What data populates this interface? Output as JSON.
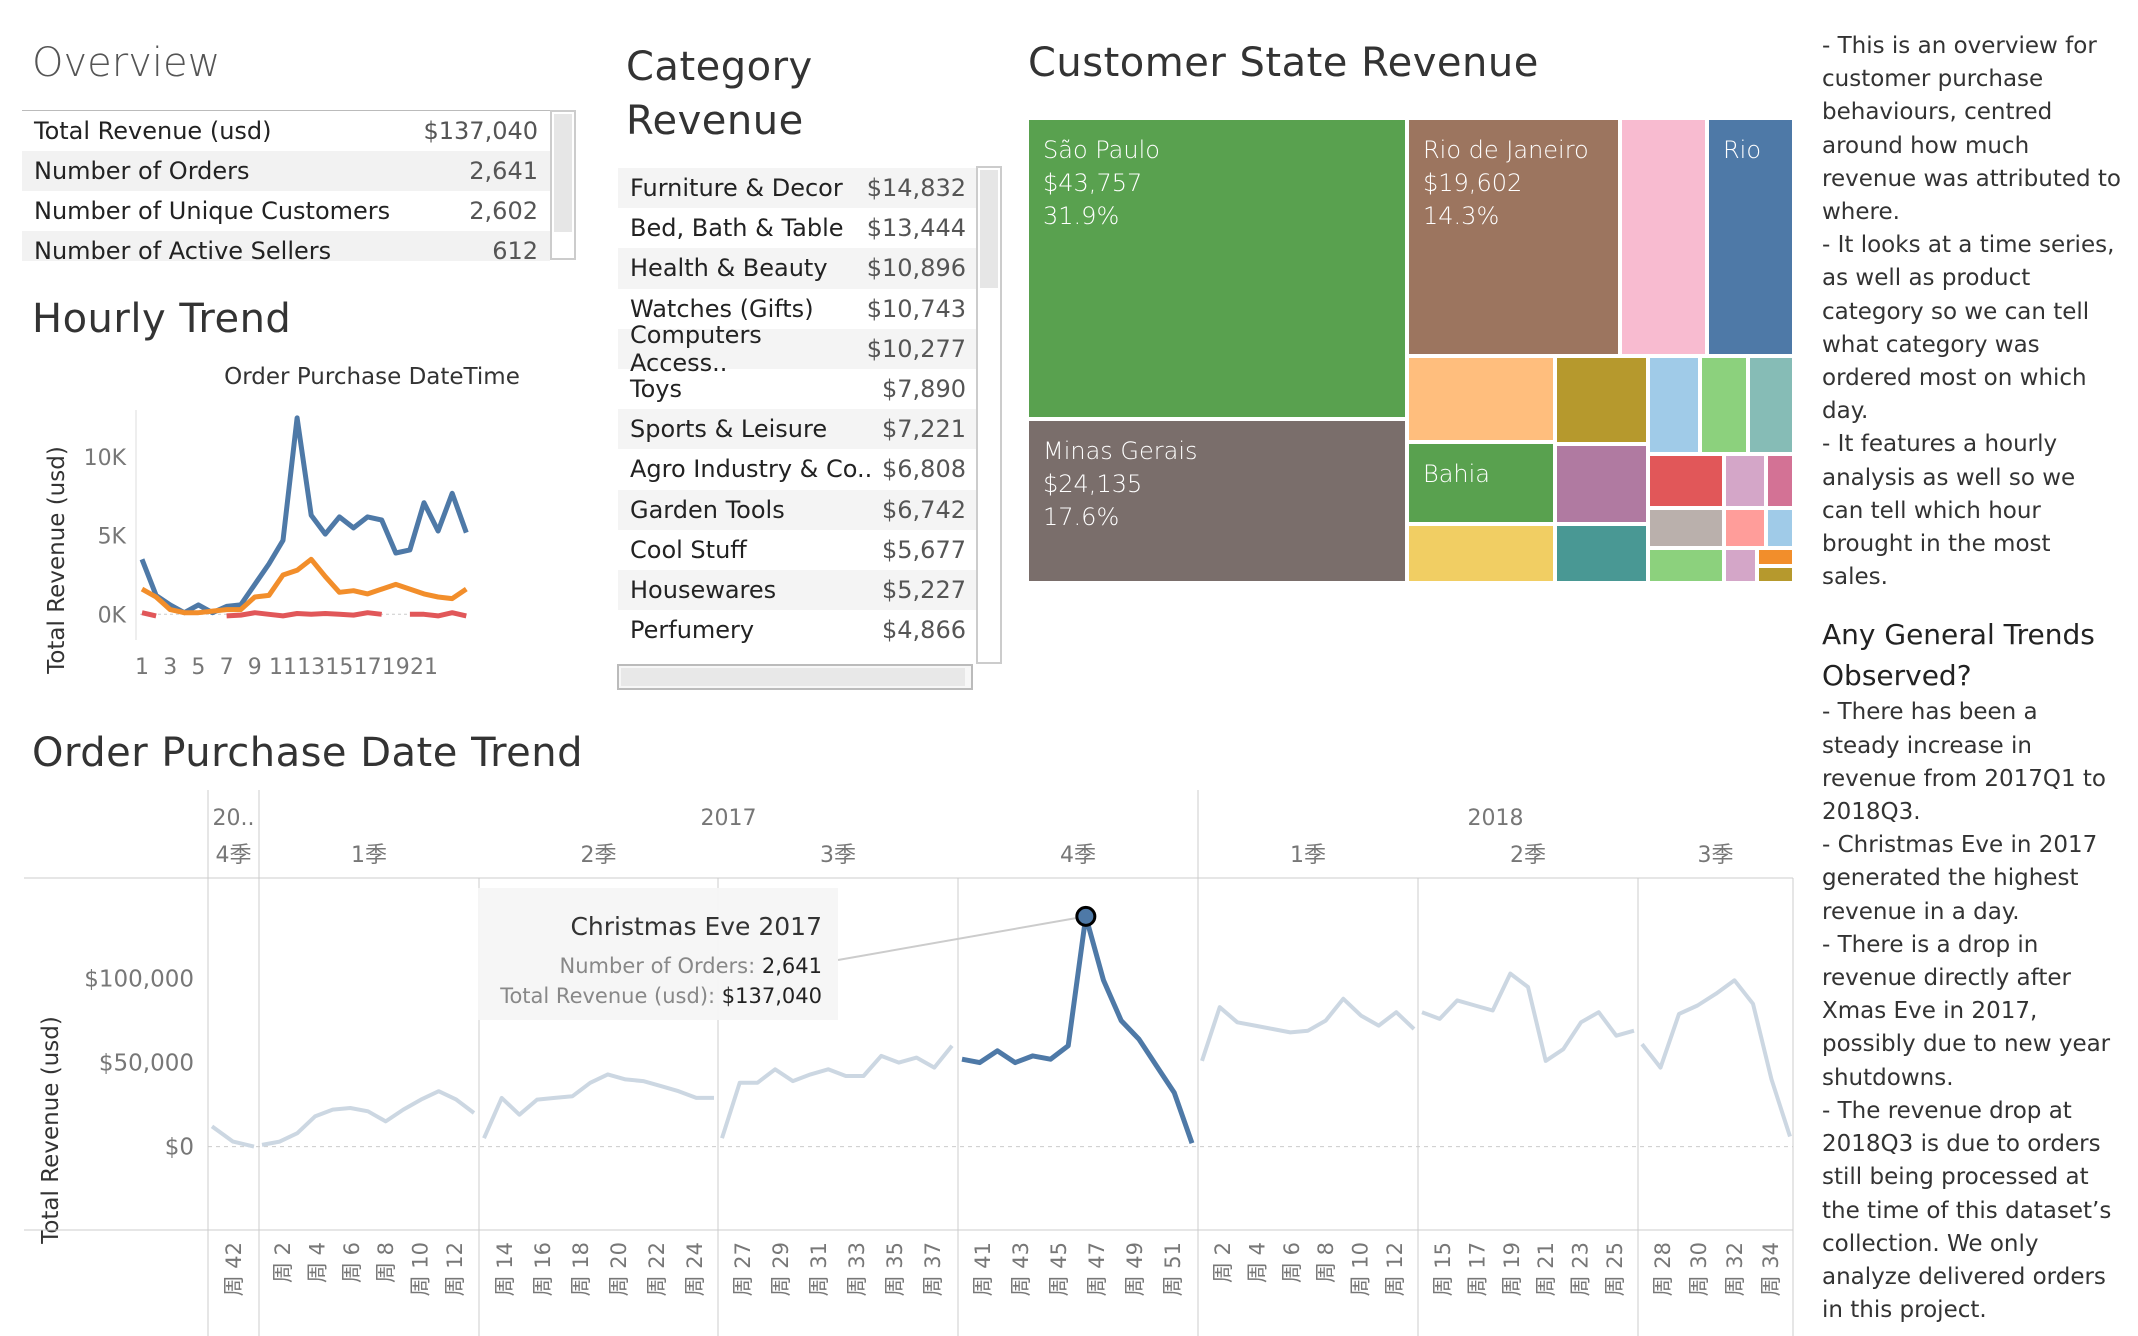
{
  "overview": {
    "title": "Overview",
    "rows": [
      {
        "label": "Total Revenue  (usd)",
        "value": "$137,040"
      },
      {
        "label": "Number of Orders",
        "value": "2,641"
      },
      {
        "label": "Number of Unique Customers",
        "value": "2,602"
      },
      {
        "label": "Number of Active Sellers",
        "value": "612"
      }
    ]
  },
  "hourly": {
    "title": "Hourly Trend",
    "chart_title": "Order Purchase DateTime",
    "ylabel": "Total Revenue  (usd)"
  },
  "category": {
    "title_line1": "Category",
    "title_line2": "Revenue",
    "rows": [
      {
        "label": "Furniture & Decor",
        "value": "$14,832"
      },
      {
        "label": "Bed, Bath & Table",
        "value": "$13,444"
      },
      {
        "label": "Health & Beauty",
        "value": "$10,896"
      },
      {
        "label": "Watches (Gifts)",
        "value": "$10,743"
      },
      {
        "label": "Computers Access..",
        "value": "$10,277"
      },
      {
        "label": "Toys",
        "value": "$7,890"
      },
      {
        "label": "Sports & Leisure",
        "value": "$7,221"
      },
      {
        "label": "Agro Industry & Co..",
        "value": "$6,808"
      },
      {
        "label": "Garden Tools",
        "value": "$6,742"
      },
      {
        "label": "Cool Stuff",
        "value": "$5,677"
      },
      {
        "label": "Housewares",
        "value": "$5,227"
      },
      {
        "label": "Perfumery",
        "value": "$4,866"
      }
    ]
  },
  "state": {
    "title": "Customer State Revenue",
    "tiles": [
      {
        "name": "São Paulo",
        "revenue": "$43,757",
        "pct": "31.9%",
        "color": "#59a14f"
      },
      {
        "name": "Minas Gerais",
        "revenue": "$24,135",
        "pct": "17.6%",
        "color": "#7a6e6b"
      },
      {
        "name": "Rio de Janeiro",
        "revenue": "$19,602",
        "pct": "14.3%",
        "color": "#9c755f"
      },
      {
        "name": "Rio",
        "color": "#4e79a7"
      },
      {
        "name": "Bahia",
        "color": "#59a14f"
      }
    ]
  },
  "notes": {
    "intro": "- This is an overview for customer purchase behaviours, centred around how much revenue was attributed to where.",
    "p2": "- It looks at a time series, as well as product category so we can tell what category was ordered most on which day.",
    "p3": "- It features a hourly analysis as well so we can tell which hour brought in the most sales.",
    "heading": "Any General Trends Observed?",
    "t1": "- There has been a steady increase in revenue from 2017Q1 to 2018Q3.",
    "t2": "- Christmas Eve in 2017 generated the highest revenue in a day.",
    "t3": "- There is a drop in revenue directly after Xmas Eve in 2017, possibly due to new year shutdowns.",
    "t4": "- The revenue drop at 2018Q3 is due to orders still being processed at the time of this dataset’s collection. We only analyze delivered orders in this project."
  },
  "trend": {
    "title": "Order Purchase Date Trend",
    "ylabel": "Total Revenue  (usd)",
    "years": [
      "20..",
      "2017",
      "2018"
    ],
    "quarters": [
      "4季",
      "1季",
      "2季",
      "3季",
      "4季",
      "1季",
      "2季",
      "3季"
    ],
    "tooltip": {
      "title": "Christmas Eve 2017",
      "orders_label": "Number of Orders:",
      "orders_value": "2,641",
      "revenue_label": "Total Revenue  (usd):",
      "revenue_value": "$137,040"
    }
  },
  "chart_data": [
    {
      "type": "line",
      "title": "Order Purchase DateTime",
      "ylabel": "Total Revenue  (usd)",
      "x": [
        0,
        1,
        2,
        3,
        4,
        5,
        6,
        7,
        8,
        9,
        10,
        11,
        12,
        13,
        14,
        15,
        16,
        17,
        18,
        19,
        20,
        21,
        22,
        23
      ],
      "x_tick_labels": [
        "1",
        "3",
        "5",
        "7",
        "9",
        "11",
        "13",
        "15",
        "17",
        "19",
        "21"
      ],
      "y_ticks": [
        "0K",
        "5K",
        "10K"
      ],
      "ylim": [
        -1000,
        13000
      ],
      "series": [
        {
          "color": "#4e79a7",
          "values": [
            3500,
            1200,
            600,
            100,
            600,
            100,
            500,
            600,
            1900,
            3200,
            4700,
            12500,
            6300,
            5100,
            6200,
            5500,
            6200,
            6000,
            3900,
            4100,
            7100,
            5300,
            7700,
            5200
          ]
        },
        {
          "color": "#f28e2b",
          "values": [
            1600,
            1100,
            300,
            100,
            100,
            200,
            300,
            300,
            1100,
            1200,
            2500,
            2800,
            3500,
            2400,
            1400,
            1500,
            1300,
            1600,
            1900,
            1600,
            1300,
            1100,
            1000,
            1600
          ]
        },
        {
          "color": "#e15759",
          "values": [
            100,
            -100,
            null,
            null,
            null,
            null,
            -100,
            -50,
            100,
            0,
            -100,
            50,
            0,
            50,
            0,
            -50,
            100,
            0,
            null,
            0,
            0,
            -100,
            100,
            -100
          ]
        }
      ]
    },
    {
      "type": "line",
      "title": "Order Purchase Date Trend",
      "ylabel": "Total Revenue  (usd)",
      "y_ticks": [
        "$0",
        "$50,000",
        "$100,000"
      ],
      "ylim": [
        -5000,
        145000
      ],
      "segments": [
        {
          "quarter": "2016 4季",
          "weeks": [
            41,
            42,
            43
          ],
          "values": [
            12000,
            3000,
            0
          ]
        },
        {
          "quarter": "2017 1季",
          "weeks": [
            1,
            2,
            3,
            4,
            5,
            6,
            7,
            8,
            9,
            10,
            11,
            12,
            13
          ],
          "values": [
            1000,
            3000,
            8000,
            18000,
            22000,
            23000,
            21000,
            15000,
            22000,
            28000,
            33000,
            28000,
            20000
          ]
        },
        {
          "quarter": "2017 2季",
          "weeks": [
            13,
            14,
            15,
            16,
            17,
            18,
            19,
            20,
            21,
            22,
            23,
            24,
            25,
            26
          ],
          "values": [
            5000,
            29000,
            19000,
            28000,
            29000,
            30000,
            38000,
            43000,
            40000,
            39000,
            36000,
            33000,
            29000,
            29000
          ]
        },
        {
          "quarter": "2017 3季",
          "weeks": [
            26,
            27,
            28,
            29,
            30,
            31,
            32,
            33,
            34,
            35,
            36,
            37,
            38,
            39
          ],
          "values": [
            5000,
            38000,
            38000,
            46000,
            39000,
            43000,
            46000,
            42000,
            42000,
            54000,
            50000,
            53000,
            47000,
            60000
          ]
        },
        {
          "quarter": "2017 4季",
          "weeks": [
            40,
            41,
            42,
            43,
            44,
            45,
            46,
            47,
            48,
            49,
            50,
            51,
            52
          ],
          "values": [
            52000,
            50000,
            57000,
            50000,
            54000,
            52000,
            60000,
            137040,
            99000,
            75000,
            64000,
            48000,
            32000,
            2000
          ]
        },
        {
          "quarter": "2018 1季",
          "weeks": [
            1,
            2,
            3,
            4,
            5,
            6,
            7,
            8,
            9,
            10,
            11,
            12,
            13
          ],
          "values": [
            51000,
            83000,
            74000,
            72000,
            70000,
            68000,
            69000,
            75000,
            88000,
            78000,
            72000,
            80000,
            70000
          ]
        },
        {
          "quarter": "2018 2季",
          "weeks": [
            14,
            15,
            16,
            17,
            18,
            19,
            20,
            21,
            22,
            23,
            24,
            25,
            26
          ],
          "values": [
            80000,
            76000,
            87000,
            84000,
            81000,
            103000,
            95000,
            51000,
            58000,
            74000,
            80000,
            66000,
            69000
          ]
        },
        {
          "quarter": "2018 3季",
          "weeks": [
            27,
            28,
            29,
            30,
            31,
            32,
            33,
            34,
            35
          ],
          "values": [
            61000,
            47000,
            79000,
            84000,
            91000,
            99000,
            85000,
            40000,
            6000
          ]
        }
      ],
      "x_tick_labels": [
        "周 42",
        "周 2",
        "周 4",
        "周 6",
        "周 8",
        "周 10",
        "周 12",
        "周 14",
        "周 16",
        "周 18",
        "周 20",
        "周 22",
        "周 24",
        "周 27",
        "周 29",
        "周 31",
        "周 33",
        "周 35",
        "周 37",
        "周 41",
        "周 43",
        "周 45",
        "周 47",
        "周 49",
        "周 51",
        "周 2",
        "周 4",
        "周 6",
        "周 8",
        "周 10",
        "周 12",
        "周 15",
        "周 17",
        "周 19",
        "周 21",
        "周 23",
        "周 25",
        "周 28",
        "周 30",
        "周 32",
        "周 34"
      ],
      "highlight": {
        "label": "Christmas Eve 2017",
        "value": 137040
      }
    }
  ]
}
